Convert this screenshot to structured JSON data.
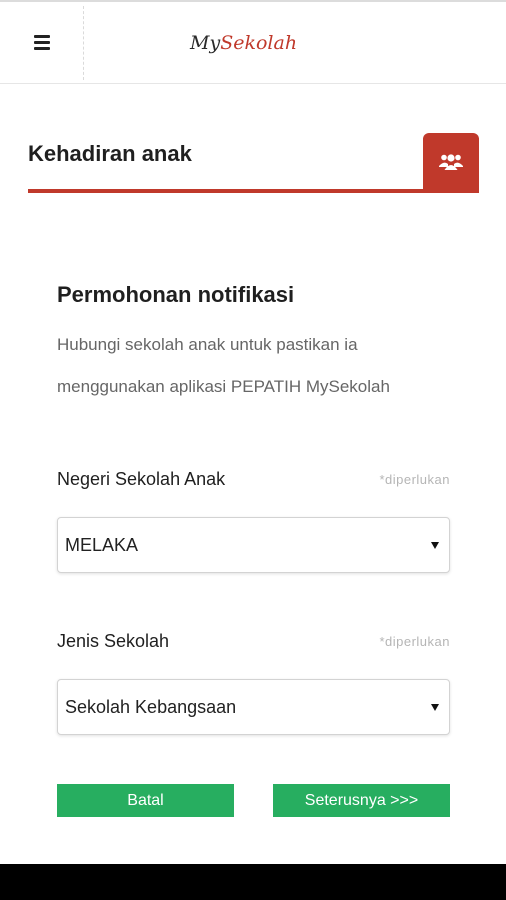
{
  "header": {
    "logo_part1": "My",
    "logo_part2": "Sekolah",
    "menu_icon": "hamburger-menu-icon"
  },
  "section": {
    "title": "Kehadiran anak",
    "icon": "users-group-icon",
    "accent_color": "#c0392b"
  },
  "form": {
    "title": "Permohonan notifikasi",
    "description_line1": "Hubungi sekolah anak untuk pastikan ia",
    "description_line2": "menggunakan aplikasi PEPATIH MySekolah",
    "fields": [
      {
        "label": "Negeri Sekolah Anak",
        "required_note": "*diperlukan",
        "value": "MELAKA"
      },
      {
        "label": "Jenis Sekolah",
        "required_note": "*diperlukan",
        "value": "Sekolah Kebangsaan"
      }
    ]
  },
  "buttons": {
    "cancel_label": "Batal",
    "next_label": "Seterusnya >>>",
    "color": "#27ae60"
  }
}
